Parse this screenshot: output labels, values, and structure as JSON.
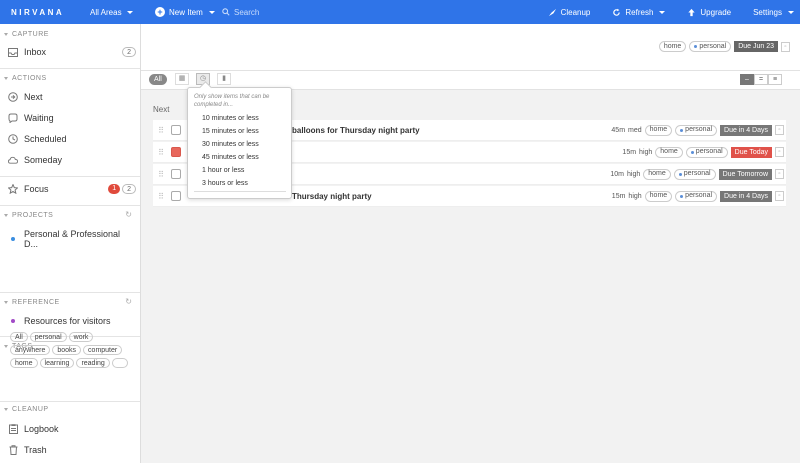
{
  "topbar": {
    "logo": "NIRVANA",
    "areas_label": "All Areas",
    "new_item_label": "New Item",
    "search_placeholder": "Search",
    "cleanup_label": "Cleanup",
    "refresh_label": "Refresh",
    "upgrade_label": "Upgrade",
    "settings_label": "Settings",
    "accent": "#2f74e8"
  },
  "sidebar": {
    "capture_head": "CAPTURE",
    "inbox_label": "Inbox",
    "inbox_count": "2",
    "actions_head": "ACTIONS",
    "next_label": "Next",
    "waiting_label": "Waiting",
    "scheduled_label": "Scheduled",
    "someday_label": "Someday",
    "focus_label": "Focus",
    "focus_count_red": "1",
    "focus_count": "2",
    "projects_head": "PROJECTS",
    "project_item": "Personal & Professional D...",
    "reference_head": "REFERENCE",
    "reference_item": "Resources for visitors",
    "tags_head": "TAGS",
    "tags": [
      "All",
      "personal",
      "work",
      "anywhere",
      "books",
      "computer",
      "home",
      "learning",
      "reading",
      ""
    ],
    "cleanup_head": "CLEANUP",
    "logbook_label": "Logbook",
    "trash_label": "Trash"
  },
  "top_panel": {
    "tag1": "home",
    "tag2": "personal",
    "due": "Due Jun 23"
  },
  "filterbar": {
    "all_label": "All"
  },
  "section_title": "Next",
  "tasks": [
    {
      "title": "balloons for Thursday night party",
      "time": "45m",
      "energy": "med",
      "tag1": "home",
      "tag2": "personal",
      "due": "Due in 4 Days",
      "due_color": "#777777"
    },
    {
      "title": "",
      "time": "15m",
      "energy": "high",
      "tag1": "home",
      "tag2": "personal",
      "due": "Due Today",
      "due_color": "#e0524a"
    },
    {
      "title": "",
      "time": "10m",
      "energy": "high",
      "tag1": "home",
      "tag2": "personal",
      "due": "Due Tomorrow",
      "due_color": "#777777"
    },
    {
      "title": "Thursday night party",
      "time": "15m",
      "energy": "high",
      "tag1": "home",
      "tag2": "personal",
      "due": "Due in 4 Days",
      "due_color": "#777777"
    }
  ],
  "dropdown": {
    "hint": "Only show items that can be completed in...",
    "options": [
      "10 minutes or less",
      "15 minutes or less",
      "30 minutes or less",
      "45 minutes or less",
      "1 hour or less",
      "3 hours or less"
    ]
  }
}
